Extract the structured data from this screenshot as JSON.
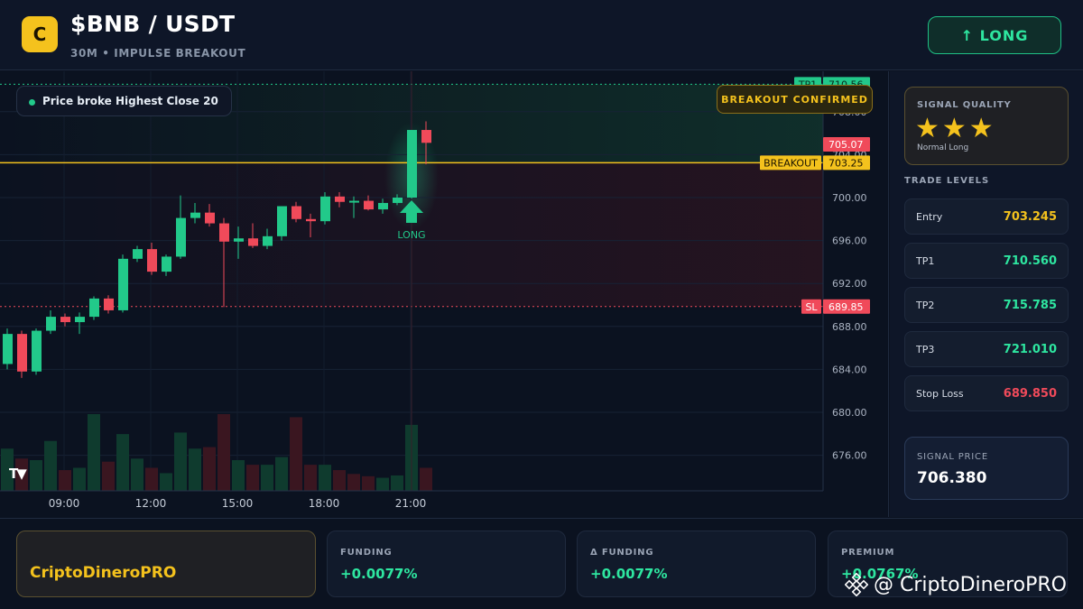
{
  "header": {
    "logo_letter": "C",
    "pair": "$BNB / USDT",
    "subtitle": "30M • IMPULSE BREAKOUT",
    "signal_button": "↑ LONG"
  },
  "chart": {
    "chip_text": "Price broke Highest Close 20",
    "breakout_banner": "BREAKOUT CONFIRMED",
    "long_marker_label": "LONG",
    "tv_logo": "TV",
    "price_labels": {
      "tp1_tag": "TP1",
      "tp1_value": "710.56",
      "current_value": "705.07",
      "breakout_tag": "BREAKOUT",
      "breakout_value": "703.25",
      "sl_tag": "SL",
      "sl_value": "689.85"
    },
    "y_ticks": [
      "708.00",
      "704.00",
      "700.00",
      "696.00",
      "692.00",
      "688.00",
      "684.00",
      "680.00",
      "676.00"
    ],
    "x_ticks": [
      "09:00",
      "12:00",
      "15:00",
      "18:00",
      "21:00"
    ],
    "colors": {
      "up": "#22c98a",
      "down": "#f04a5a",
      "breakout": "#f4c21d"
    }
  },
  "chart_data": {
    "type": "candlestick",
    "title": "$BNB / USDT",
    "x_ticks": [
      "09:00",
      "12:00",
      "15:00",
      "18:00",
      "21:00"
    ],
    "y_ticks": [
      708,
      704,
      700,
      696,
      692,
      688,
      684,
      680,
      676
    ],
    "levels": {
      "tp1": 710.56,
      "current": 705.07,
      "breakout": 703.25,
      "sl": 689.85
    },
    "candles": [
      {
        "o": 684.5,
        "h": 687.8,
        "l": 684.0,
        "c": 687.3
      },
      {
        "o": 687.3,
        "h": 687.6,
        "l": 683.2,
        "c": 683.8
      },
      {
        "o": 683.8,
        "h": 687.8,
        "l": 683.5,
        "c": 687.6
      },
      {
        "o": 687.6,
        "h": 689.5,
        "l": 687.3,
        "c": 688.9
      },
      {
        "o": 688.9,
        "h": 689.2,
        "l": 688.0,
        "c": 688.4
      },
      {
        "o": 688.4,
        "h": 689.3,
        "l": 687.3,
        "c": 688.9
      },
      {
        "o": 688.9,
        "h": 690.8,
        "l": 688.6,
        "c": 690.6
      },
      {
        "o": 690.6,
        "h": 690.9,
        "l": 689.2,
        "c": 689.5
      },
      {
        "o": 689.5,
        "h": 694.7,
        "l": 689.3,
        "c": 694.3
      },
      {
        "o": 694.3,
        "h": 695.5,
        "l": 694.0,
        "c": 695.2
      },
      {
        "o": 695.2,
        "h": 695.8,
        "l": 692.8,
        "c": 693.1
      },
      {
        "o": 693.1,
        "h": 694.7,
        "l": 692.7,
        "c": 694.5
      },
      {
        "o": 694.5,
        "h": 700.2,
        "l": 694.3,
        "c": 698.1
      },
      {
        "o": 698.1,
        "h": 699.5,
        "l": 697.6,
        "c": 698.6
      },
      {
        "o": 698.6,
        "h": 699.4,
        "l": 697.3,
        "c": 697.6
      },
      {
        "o": 697.6,
        "h": 698.1,
        "l": 689.8,
        "c": 695.9
      },
      {
        "o": 695.9,
        "h": 697.3,
        "l": 694.3,
        "c": 696.2
      },
      {
        "o": 696.2,
        "h": 697.6,
        "l": 695.3,
        "c": 695.5
      },
      {
        "o": 695.5,
        "h": 697.1,
        "l": 695.2,
        "c": 696.4
      },
      {
        "o": 696.4,
        "h": 699.2,
        "l": 696.0,
        "c": 699.2
      },
      {
        "o": 699.2,
        "h": 699.6,
        "l": 697.7,
        "c": 698.0
      },
      {
        "o": 698.0,
        "h": 698.5,
        "l": 696.3,
        "c": 697.8
      },
      {
        "o": 697.8,
        "h": 700.5,
        "l": 697.5,
        "c": 700.1
      },
      {
        "o": 700.1,
        "h": 700.5,
        "l": 699.1,
        "c": 699.6
      },
      {
        "o": 699.6,
        "h": 700.1,
        "l": 698.1,
        "c": 699.7
      },
      {
        "o": 699.7,
        "h": 700.2,
        "l": 698.8,
        "c": 698.9
      },
      {
        "o": 698.9,
        "h": 699.9,
        "l": 698.5,
        "c": 699.5
      },
      {
        "o": 699.5,
        "h": 700.3,
        "l": 699.3,
        "c": 700.0
      },
      {
        "o": 700.0,
        "h": 706.2,
        "l": 699.9,
        "c": 706.3
      },
      {
        "o": 706.3,
        "h": 707.1,
        "l": 703.1,
        "c": 705.1
      }
    ],
    "volume": [
      {
        "v": 0.55,
        "up": true
      },
      {
        "v": 0.42,
        "up": false
      },
      {
        "v": 0.4,
        "up": true
      },
      {
        "v": 0.65,
        "up": true
      },
      {
        "v": 0.27,
        "up": false
      },
      {
        "v": 0.3,
        "up": true
      },
      {
        "v": 1.0,
        "up": true
      },
      {
        "v": 0.38,
        "up": false
      },
      {
        "v": 0.74,
        "up": true
      },
      {
        "v": 0.42,
        "up": true
      },
      {
        "v": 0.3,
        "up": false
      },
      {
        "v": 0.23,
        "up": true
      },
      {
        "v": 0.76,
        "up": true
      },
      {
        "v": 0.55,
        "up": true
      },
      {
        "v": 0.57,
        "up": false
      },
      {
        "v": 1.0,
        "up": false
      },
      {
        "v": 0.4,
        "up": true
      },
      {
        "v": 0.34,
        "up": false
      },
      {
        "v": 0.34,
        "up": true
      },
      {
        "v": 0.44,
        "up": true
      },
      {
        "v": 0.96,
        "up": false
      },
      {
        "v": 0.34,
        "up": false
      },
      {
        "v": 0.34,
        "up": true
      },
      {
        "v": 0.27,
        "up": false
      },
      {
        "v": 0.22,
        "up": false
      },
      {
        "v": 0.19,
        "up": false
      },
      {
        "v": 0.17,
        "up": true
      },
      {
        "v": 0.2,
        "up": true
      },
      {
        "v": 0.86,
        "up": true
      },
      {
        "v": 0.3,
        "up": false
      }
    ]
  },
  "panel": {
    "quality_title": "SIGNAL QUALITY",
    "stars": "★★★",
    "quality_sub": "Normal Long",
    "levels_title": "TRADE LEVELS",
    "levels": [
      {
        "label": "Entry",
        "value": "703.245",
        "color": "#f4c21d"
      },
      {
        "label": "TP1",
        "value": "710.560",
        "color": "#2ee6a0"
      },
      {
        "label": "TP2",
        "value": "715.785",
        "color": "#2ee6a0"
      },
      {
        "label": "TP3",
        "value": "721.010",
        "color": "#2ee6a0"
      },
      {
        "label": "Stop Loss",
        "value": "689.850",
        "color": "#f04a5a"
      }
    ],
    "signal_price_label": "SIGNAL PRICE",
    "signal_price_value": "706.380"
  },
  "footer": {
    "brand": "CriptoDineroPRO",
    "stats": [
      {
        "label": "FUNDING",
        "value": "+0.0077%"
      },
      {
        "label": "Δ FUNDING",
        "value": "+0.0077%"
      },
      {
        "label": "PREMIUM",
        "value": "+0.0767%"
      }
    ],
    "watermark": "@ CriptoDineroPRO"
  }
}
